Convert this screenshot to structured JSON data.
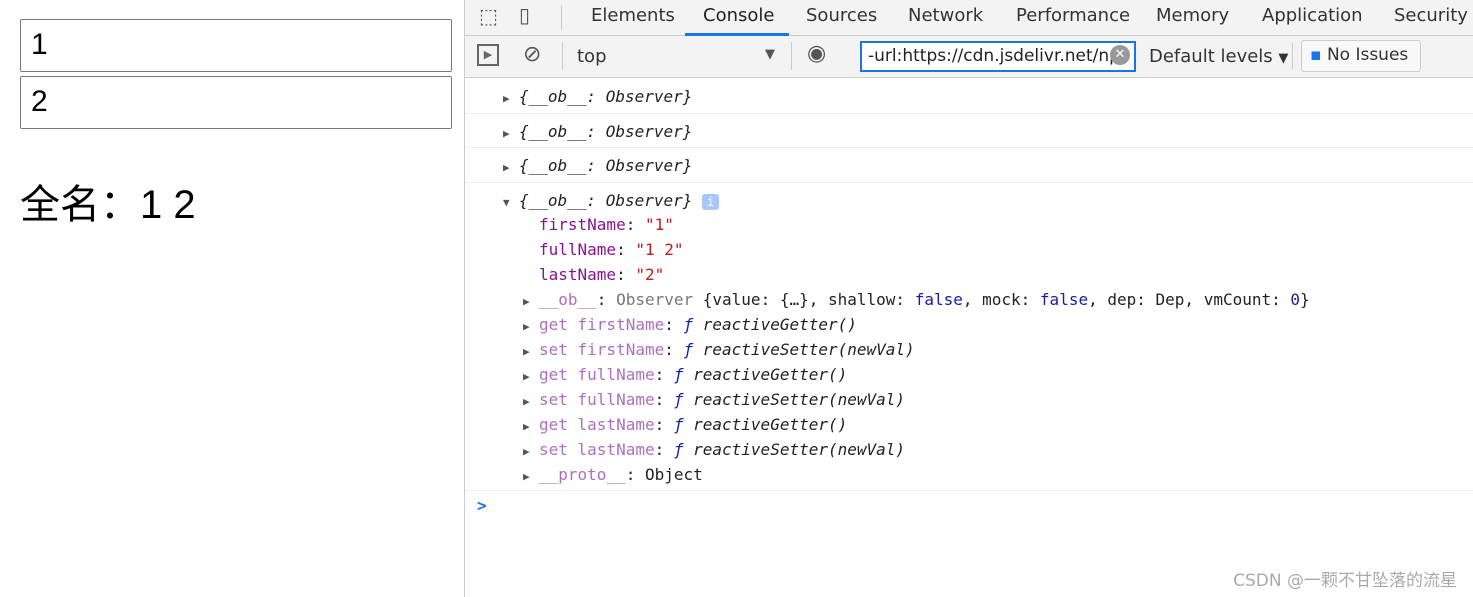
{
  "page": {
    "first_input": "1",
    "last_input": "2",
    "full_name_label": "全名：",
    "full_name_value": "1 2"
  },
  "devtools": {
    "tabs": [
      "Elements",
      "Console",
      "Sources",
      "Network",
      "Performance",
      "Memory",
      "Application",
      "Security"
    ],
    "active_tab": "Console",
    "toolbar": {
      "context": "top",
      "filter_value": "-url:https://cdn.jsdelivr.net/np",
      "levels": "Default levels",
      "issues": "No Issues"
    },
    "collapsed_logs": [
      "{__ob__: Observer}",
      "{__ob__: Observer}",
      "{__ob__: Observer}"
    ],
    "expanded_log": {
      "summary": "{__ob__: Observer}",
      "props": [
        {
          "key": "firstName",
          "value": "\"1\""
        },
        {
          "key": "fullName",
          "value": "\"1 2\""
        },
        {
          "key": "lastName",
          "value": "\"2\""
        }
      ],
      "ob_line": {
        "key": "__ob__",
        "type": "Observer",
        "p1": "{value: {…}, shallow: ",
        "v1": "false",
        "p2": ", mock: ",
        "v2": "false",
        "p3": ", dep: Dep, vmCount: ",
        "v3": "0",
        "p4": "}"
      },
      "accessors": [
        {
          "key": "get firstName",
          "fn": "reactiveGetter()"
        },
        {
          "key": "set firstName",
          "fn": "reactiveSetter(newVal)"
        },
        {
          "key": "get fullName",
          "fn": "reactiveGetter()"
        },
        {
          "key": "set fullName",
          "fn": "reactiveSetter(newVal)"
        },
        {
          "key": "get lastName",
          "fn": "reactiveGetter()"
        },
        {
          "key": "set lastName",
          "fn": "reactiveSetter(newVal)"
        }
      ],
      "proto": {
        "key": "__proto__",
        "value": "Object"
      }
    },
    "prompt": ">"
  },
  "watermark": "CSDN @一颗不甘坠落的流星"
}
